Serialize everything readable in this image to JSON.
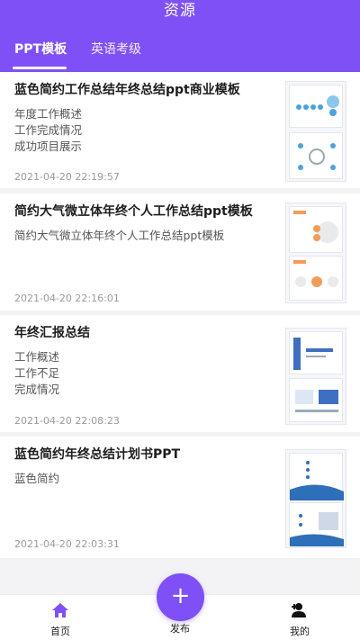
{
  "header": {
    "title": "资源",
    "tabs": [
      {
        "label": "PPT模板",
        "active": true
      },
      {
        "label": "英语考级",
        "active": false
      }
    ]
  },
  "items": [
    {
      "title": "蓝色简约工作总结年终总结ppt商业模板",
      "lines": [
        "年度工作概述",
        "工作完成情况",
        "成功项目展示"
      ],
      "time": "2021-04-20 22:19:57"
    },
    {
      "title": "简约大气微立体年终个人工作总结ppt模板",
      "lines": [
        "简约大气微立体年终个人工作总结ppt模板"
      ],
      "time": "2021-04-20 22:16:01"
    },
    {
      "title": "年终汇报总结",
      "lines": [
        "工作概述",
        "工作不足",
        "完成情况"
      ],
      "time": "2021-04-20 22:08:23"
    },
    {
      "title": "蓝色简约年终总结计划书PPT",
      "lines": [
        "蓝色简约"
      ],
      "time": "2021-04-20 22:03:31"
    }
  ],
  "bottom_nav": {
    "home": {
      "label": "首页",
      "icon": "home-icon"
    },
    "publish": {
      "label": "发布",
      "icon": "plus-icon",
      "glyph": "+"
    },
    "mine": {
      "label": "我的",
      "icon": "add-user-icon"
    }
  },
  "colors": {
    "accent": "#7f50f5",
    "background": "#f3f3f5"
  }
}
